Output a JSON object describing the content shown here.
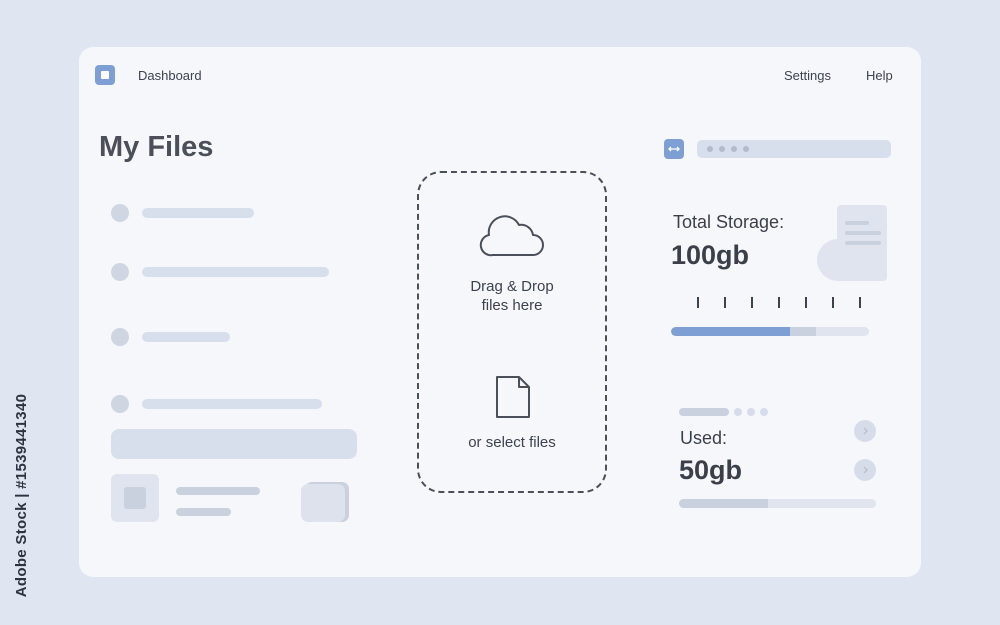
{
  "watermark": {
    "text": "Adobe Stock | #1539441340"
  },
  "header": {
    "app_title": "Dashboard",
    "nav": [
      {
        "label": "Settings"
      },
      {
        "label": "Help"
      }
    ]
  },
  "main": {
    "title": "My Files"
  },
  "upload": {
    "drag_line1": "Drag & Drop",
    "drag_line2": "files here",
    "select_label": "or select files",
    "icons": {
      "drop": "cloud-icon",
      "select": "file-icon"
    }
  },
  "storage": {
    "total_label": "Total Storage:",
    "total_value": "100gb",
    "progress_fraction": 0.6,
    "progress_color": "#7e9fd4"
  },
  "usage": {
    "used_label": "Used:",
    "used_value": "50gb",
    "progress_fraction": 0.45
  },
  "colors": {
    "background": "#dfe5f1",
    "card": "#f5f7fb",
    "accent": "#7e9fd4",
    "placeholder": "#d8dfec"
  }
}
